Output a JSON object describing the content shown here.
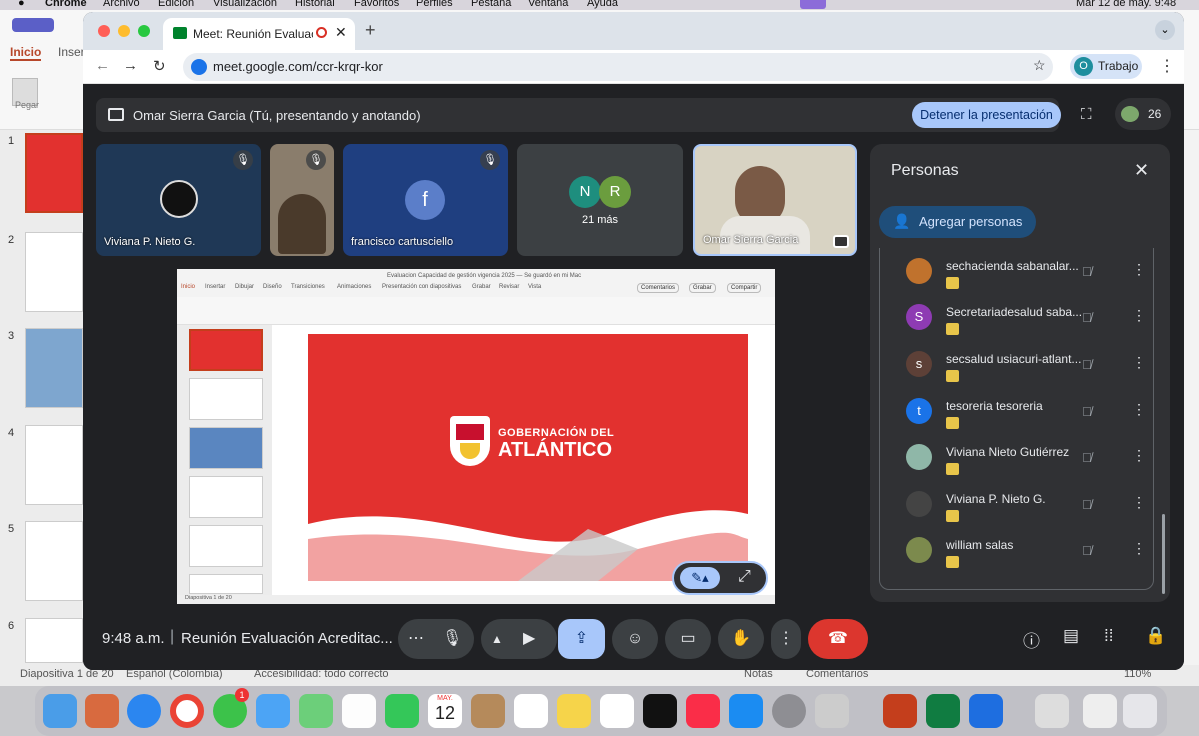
{
  "menubar": {
    "app_name": "Chrome",
    "items": [
      "Archivo",
      "Edición",
      "Visualización",
      "Historial",
      "Favoritos",
      "Perfiles",
      "Pestaña",
      "Ventana",
      "Ayuda"
    ],
    "clock": "Mar 12 de may.  9:48"
  },
  "ppt": {
    "tabs": [
      "Inicio",
      "Inser"
    ],
    "paste_label": "Pegar",
    "slide_numbers": [
      "1",
      "2",
      "3",
      "4",
      "5",
      "6"
    ],
    "status_slide": "Diapositiva 1 de 20",
    "status_lang": "Español (Colombia)",
    "status_access": "Accesibilidad: todo correcto",
    "status_notes": "Notas",
    "status_comments": "Comentarios",
    "status_zoom": "110%"
  },
  "browser": {
    "tab_title": "Meet: Reunión Evaluación",
    "new_tab": "+",
    "url": "meet.google.com/ccr-krqr-kor",
    "profile_initial": "O",
    "profile_label": "Trabajo"
  },
  "meet": {
    "presenting_text": "Omar Sierra Garcia (Tú, presentando y anotando)",
    "stop_button": "Detener la presentación",
    "participant_count": "26",
    "tiles": [
      {
        "name": "Viviana P. Nieto G."
      },
      {
        "name": ""
      },
      {
        "name": "francisco cartusciello",
        "initial": "f"
      },
      {
        "name": "21 más",
        "initials": [
          "N",
          "R"
        ]
      },
      {
        "name": "Omar Sierra Garcia"
      }
    ],
    "shared_window": {
      "title": "Evaluacion Capacidad de gestión vigencia 2025 — Se guardó en mi Mac",
      "ribbon_tabs": [
        "Inicio",
        "Insertar",
        "Dibujar",
        "Diseño",
        "Transiciones",
        "Animaciones",
        "Presentación con diapositivas",
        "Grabar",
        "Revisar",
        "Vista"
      ],
      "btn_comments": "Comentarios",
      "btn_record": "Grabar",
      "btn_share": "Compartir",
      "slide_logo_line1": "GOBERNACIÓN DEL",
      "slide_logo_line2": "ATLÁNTICO",
      "status": "Diapositiva 1 de 20"
    },
    "time": "9:48 a.m.",
    "meeting_title": "Reunión Evaluación Acreditac...",
    "colors": {
      "accent": "#a8c7fa",
      "end_call": "#dc362e",
      "panel": "#303134",
      "red_slide": "#e2312f"
    }
  },
  "people": {
    "title": "Personas",
    "add_button": "Agregar personas",
    "list": [
      {
        "name": "sechacienda sabanalar...",
        "avatar": "",
        "color": "#c0722d"
      },
      {
        "name": "Secretariadesalud saba...",
        "avatar": "S",
        "color": "#8e3bb3"
      },
      {
        "name": "secsalud usiacuri-atlant...",
        "avatar": "s",
        "color": "#5d4037"
      },
      {
        "name": "tesoreria tesoreria",
        "avatar": "t",
        "color": "#1a73e8"
      },
      {
        "name": "Viviana Nieto Gutiérrez",
        "avatar": "",
        "color": "#8fb7a8"
      },
      {
        "name": "Viviana P. Nieto G.",
        "avatar": "",
        "color": "#444"
      },
      {
        "name": "william salas",
        "avatar": "",
        "color": "#7c8a4d"
      }
    ]
  },
  "dock": {
    "calendar_month": "MAY.",
    "calendar_day": "12",
    "badge": "1"
  }
}
